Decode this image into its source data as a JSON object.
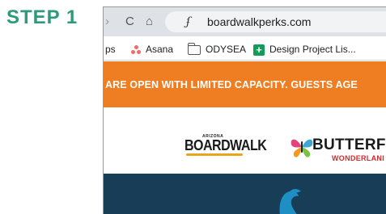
{
  "step_label": "STEP 1",
  "browser": {
    "url": "boardwalkperks.com",
    "back_glyph": "›",
    "reload_glyph": "C",
    "home_glyph": "⌂",
    "site_icon_glyph": "ʄ"
  },
  "bookmarks": {
    "apps_label": "ps",
    "items": [
      {
        "label": "Asana",
        "icon": "asana-icon"
      },
      {
        "label": "ODYSEA",
        "icon": "folder-icon"
      },
      {
        "label": "Design Project Lis...",
        "icon": "google-sheets-icon"
      }
    ]
  },
  "banner": {
    "text": "ARE OPEN WITH LIMITED CAPACITY. GUESTS AGE",
    "color": "#ef7d22"
  },
  "logos": {
    "boardwalk": {
      "top": "ARIZONA",
      "main": "BOARDWALK"
    },
    "butterfly": {
      "main": "BUTTERFL",
      "sub": "WONDERLANI"
    }
  },
  "colors": {
    "step_label": "#2d9a78",
    "toolbar_bg": "#dee1e6",
    "bottom_bg": "#183d56",
    "penguin": "#1e8fc4"
  }
}
